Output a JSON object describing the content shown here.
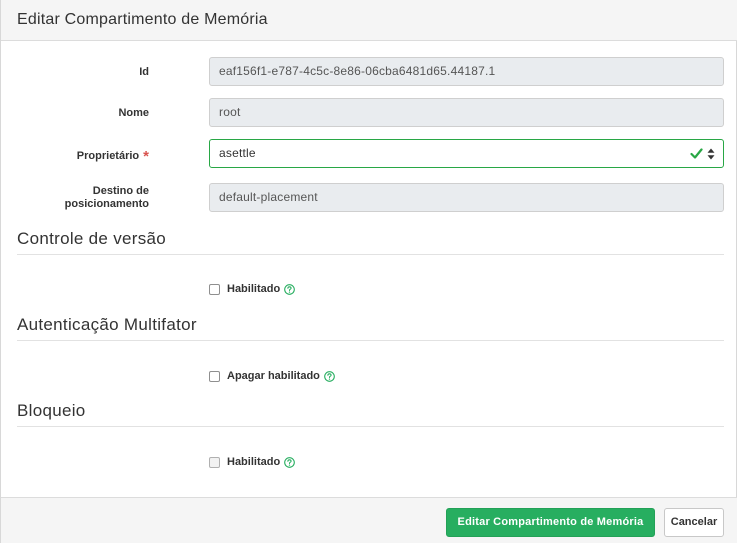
{
  "dialog": {
    "title": "Editar Compartimento de Memória"
  },
  "form": {
    "id": {
      "label": "Id",
      "value": "eaf156f1-e787-4c5c-8e86-06cba6481d65.44187.1"
    },
    "name": {
      "label": "Nome",
      "value": "root"
    },
    "owner": {
      "label": "Proprietário",
      "required_mark": "*",
      "value": "asettle",
      "valid": true
    },
    "placement": {
      "label_line1": "Destino de",
      "label_line2": "posicionamento",
      "value": "default-placement"
    }
  },
  "sections": {
    "versioning": {
      "title": "Controle de versão",
      "checkbox_label": "Habilitado",
      "checked": false
    },
    "mfa": {
      "title": "Autenticação Multifator",
      "checkbox_label": "Apagar habilitado",
      "checked": false
    },
    "lock": {
      "title": "Bloqueio",
      "checkbox_label": "Habilitado",
      "checked": false,
      "disabled": true
    }
  },
  "footer": {
    "submit_label": "Editar Compartimento de Memória",
    "cancel_label": "Cancelar"
  },
  "colors": {
    "primary": "#27ae60",
    "valid_border": "#28a745",
    "required": "#d9534f",
    "help_icon": "#27ae60"
  },
  "icons": {
    "valid": "check-icon",
    "select_arrows": "sort-updown-icon",
    "help": "question-circle-icon"
  }
}
